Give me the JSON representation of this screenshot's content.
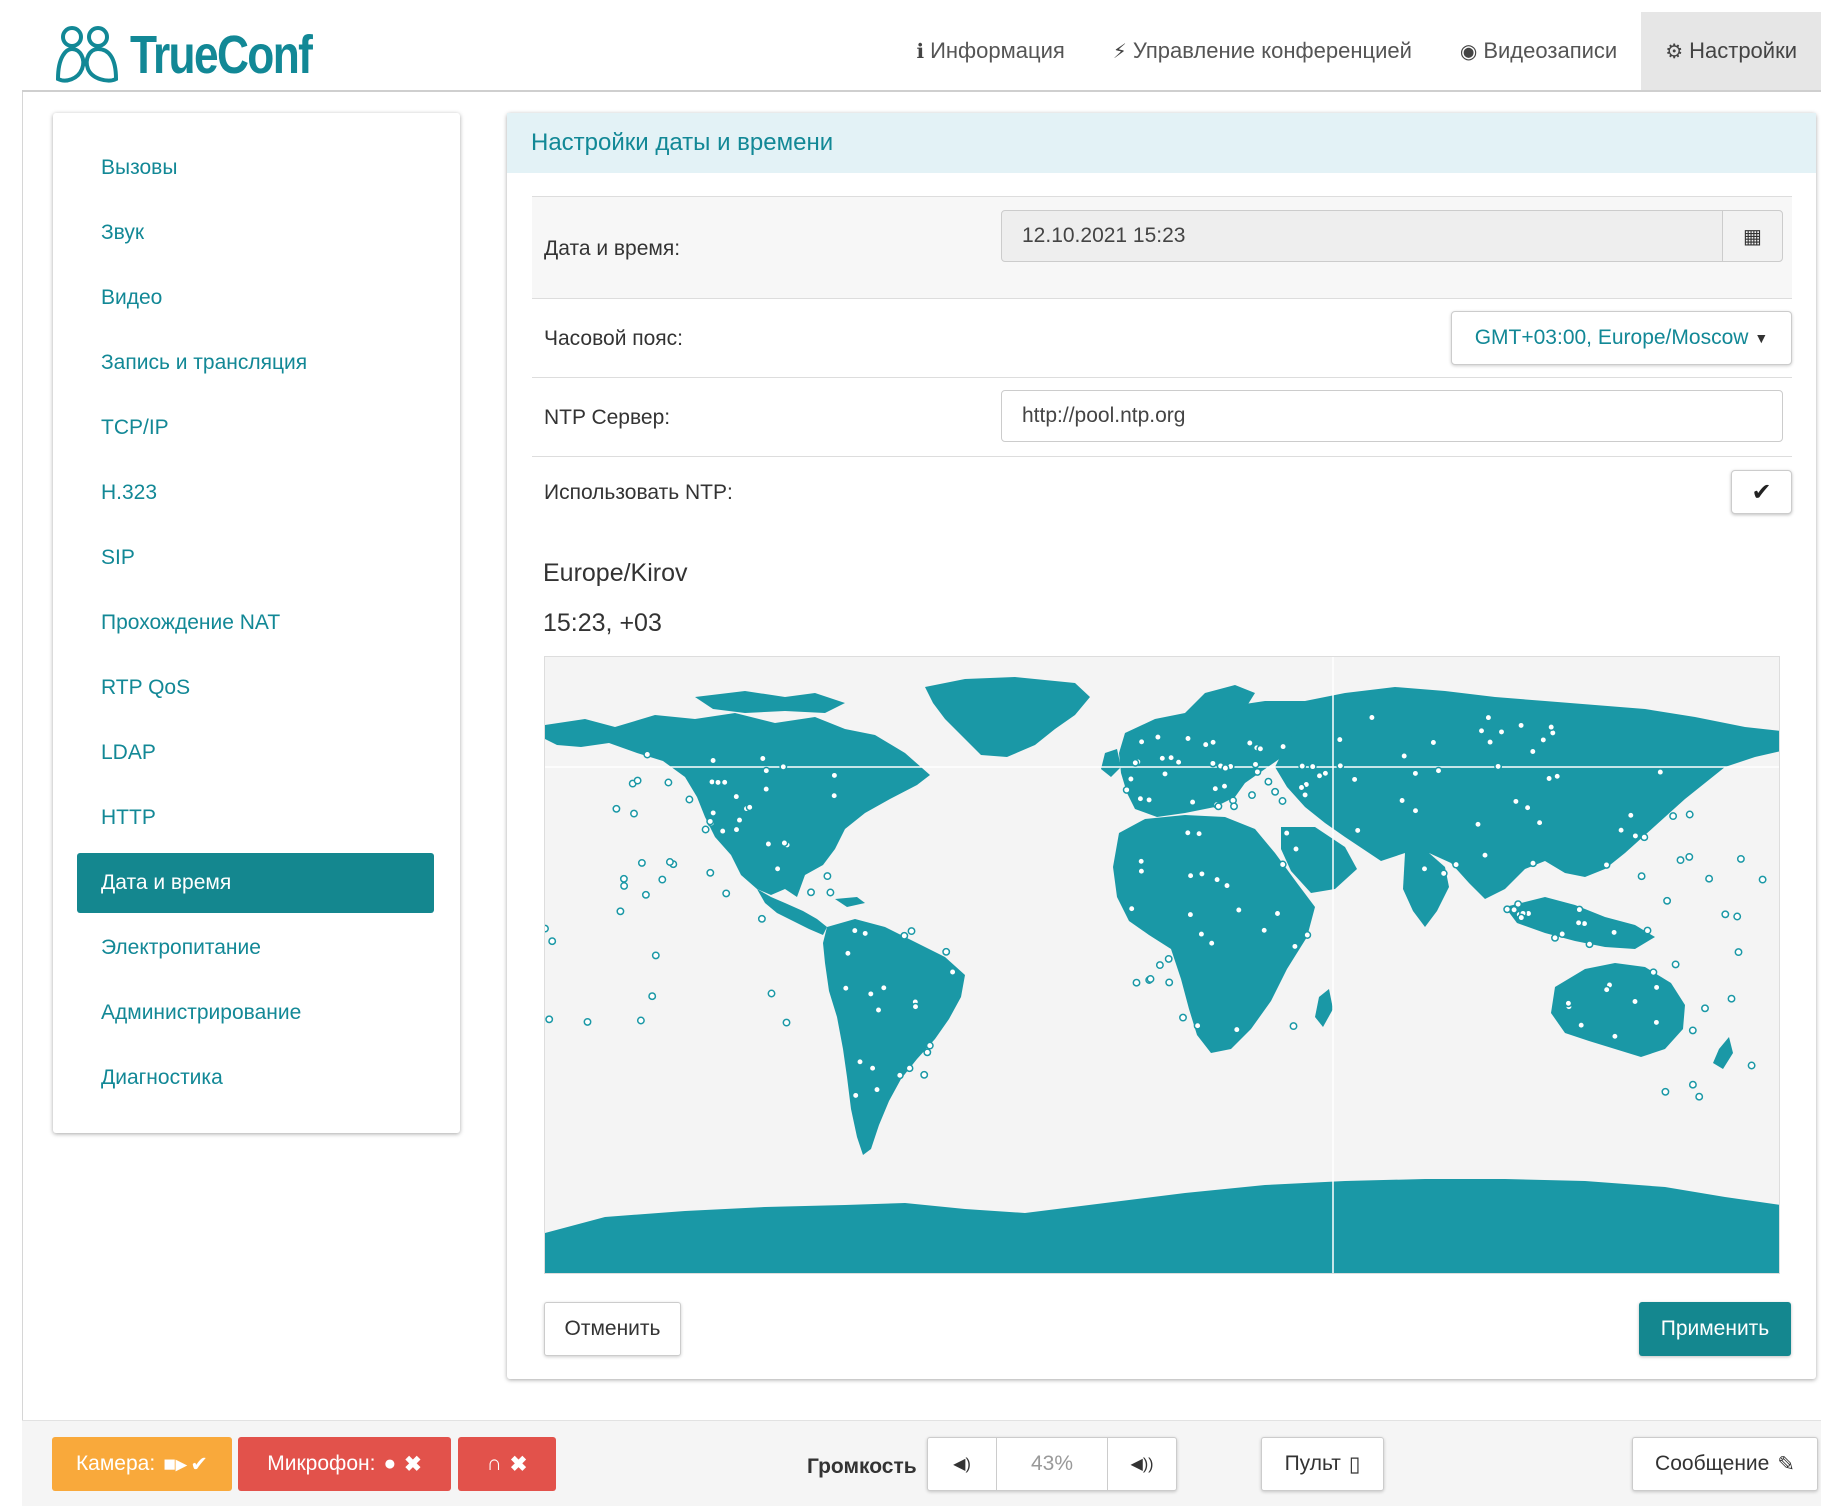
{
  "header": {
    "logo_text": "TrueConf",
    "nav": [
      {
        "label": "Информация",
        "icon": "info-circle-icon"
      },
      {
        "label": "Управление конференцией",
        "icon": "bolt-icon"
      },
      {
        "label": "Видеозаписи",
        "icon": "record-icon"
      },
      {
        "label": "Настройки",
        "icon": "gear-icon",
        "active": true
      }
    ]
  },
  "sidebar": {
    "items": [
      {
        "label": "Вызовы"
      },
      {
        "label": "Звук"
      },
      {
        "label": "Видео"
      },
      {
        "label": "Запись и трансляция"
      },
      {
        "label": "TCP/IP"
      },
      {
        "label": "H.323"
      },
      {
        "label": "SIP"
      },
      {
        "label": "Прохождение NAT"
      },
      {
        "label": "RTP QoS"
      },
      {
        "label": "LDAP"
      },
      {
        "label": "HTTP"
      },
      {
        "label": "Дата и время",
        "active": true
      },
      {
        "label": "Электропитание"
      },
      {
        "label": "Администрирование"
      },
      {
        "label": "Диагностика"
      }
    ]
  },
  "panel": {
    "title": "Настройки даты и времени",
    "datetime_label": "Дата и время:",
    "datetime_value": "12.10.2021 15:23",
    "timezone_label": "Часовой пояс:",
    "timezone_value": "GMT+03:00, Europe/Moscow",
    "ntp_label": "NTP Сервер:",
    "ntp_value": "http://pool.ntp.org",
    "use_ntp_label": "Использовать NTP:",
    "use_ntp_checked": true,
    "selected_zone": "Europe/Kirov",
    "selected_time": "15:23, +03",
    "cancel_label": "Отменить",
    "apply_label": "Применить"
  },
  "bottombar": {
    "camera_label": "Камера:",
    "mic_label": "Микрофон:",
    "volume_label": "Громкость",
    "volume_value": "43%",
    "remote_label": "Пульт",
    "message_label": "Сообщение"
  },
  "colors": {
    "accent": "#14878f",
    "map_land": "#1a98a6",
    "camera": "#f9a93b",
    "danger": "#e2524b"
  }
}
